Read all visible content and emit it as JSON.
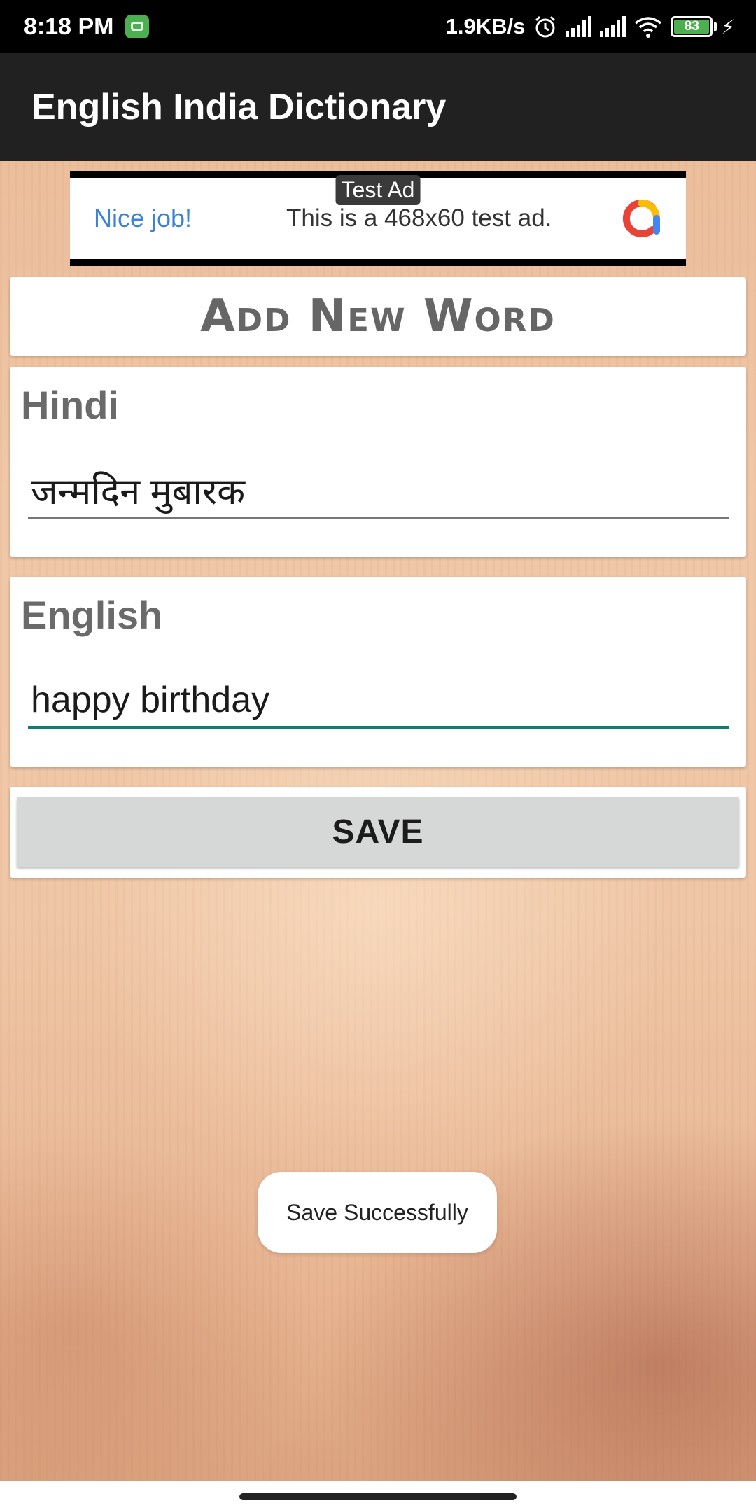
{
  "status_bar": {
    "time": "8:18 PM",
    "net_speed": "1.9KB/s",
    "battery": "83",
    "icons": [
      "app-notification-icon",
      "alarm-icon",
      "signal-icon",
      "signal-icon",
      "wifi-icon",
      "battery-icon",
      "charging-icon"
    ]
  },
  "app_bar": {
    "title": "English India Dictionary"
  },
  "ad": {
    "badge": "Test Ad",
    "headline": "Nice job!",
    "text": "This is a 468x60 test ad.",
    "icon": "adchoices-logo-icon"
  },
  "form": {
    "title": "Add New Word",
    "hindi_label": "Hindi",
    "hindi_value": "जन्मदिन मुबारक",
    "english_label": "English",
    "english_value": "happy birthday",
    "save_label": "SAVE"
  },
  "toast": {
    "message": "Save Successfully"
  },
  "colors": {
    "app_bar": "#212121",
    "accent": "#0b8070",
    "ad_link": "#3b82d9",
    "battery": "#4caf50"
  }
}
